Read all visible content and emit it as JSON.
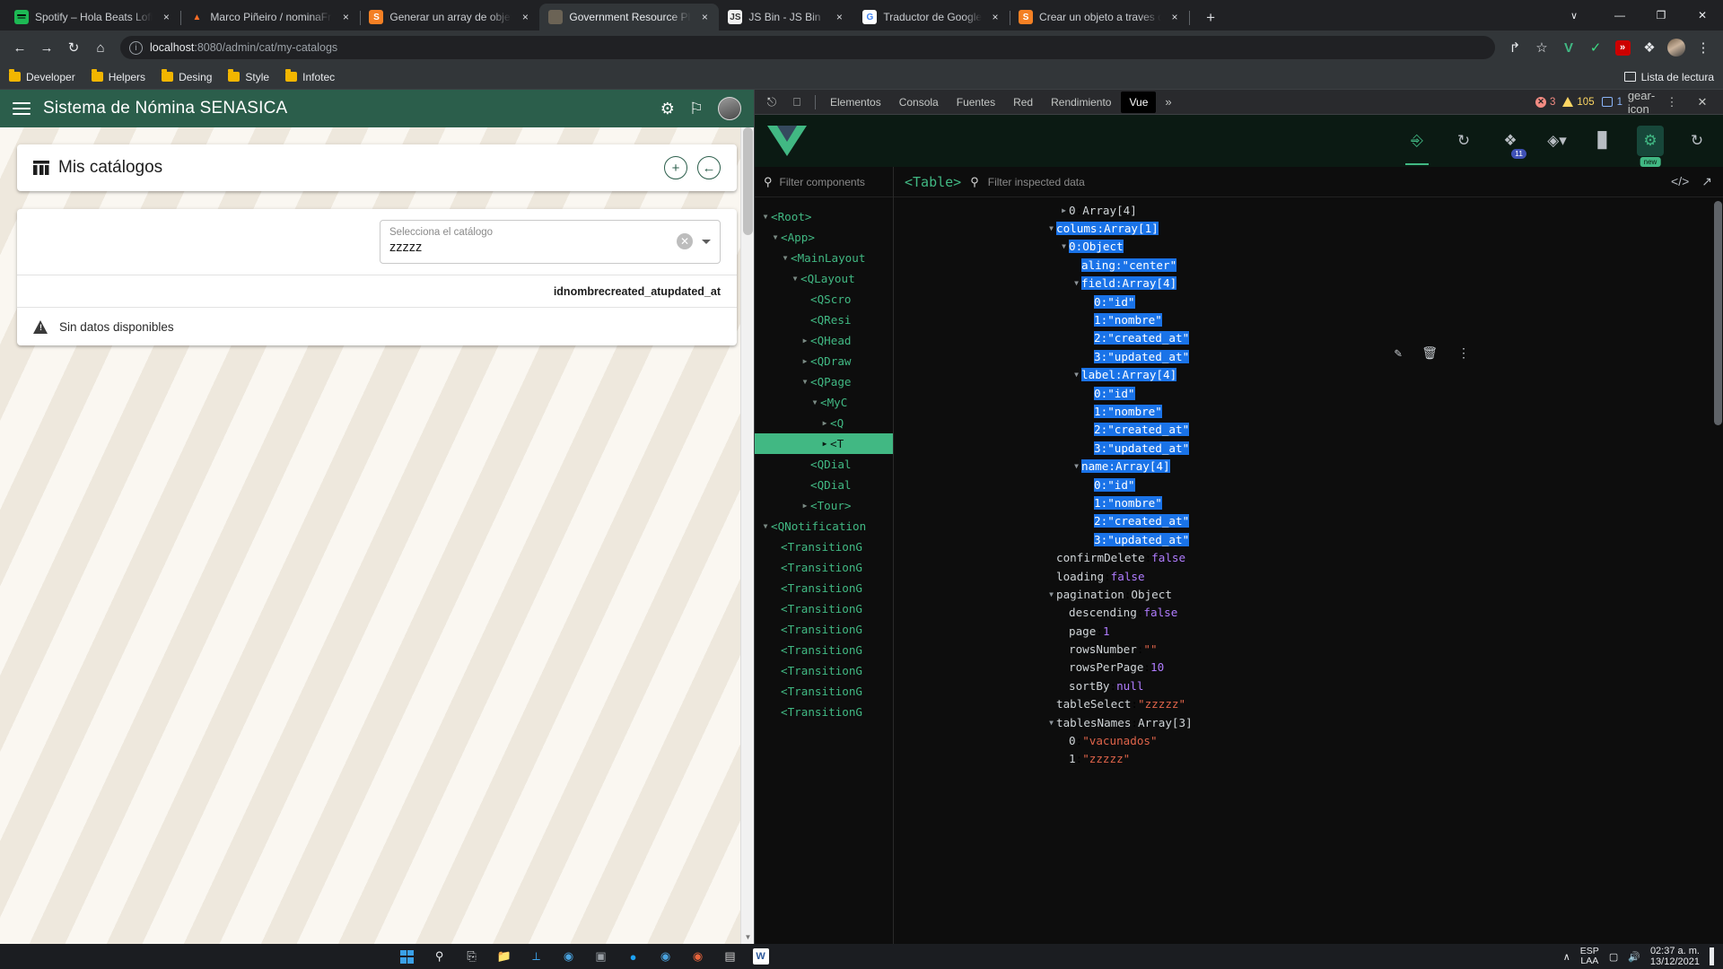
{
  "browser": {
    "tabs": [
      {
        "title": "Spotify – Hola Beats Lofi",
        "favicon": "spotify-icon",
        "active": false
      },
      {
        "title": "Marco Piñeiro / nominaFront · G",
        "favicon": "gitlab-icon",
        "active": false
      },
      {
        "title": "Generar un array de objetos a tr",
        "favicon": "stackoverflow-icon",
        "active": false
      },
      {
        "title": "Government Resource Planning",
        "favicon": "gob-icon",
        "active": true
      },
      {
        "title": "JS Bin - JS Bin",
        "favicon": "jsbin-icon",
        "active": false
      },
      {
        "title": "Traductor de Google",
        "favicon": "google-translate-icon",
        "active": false
      },
      {
        "title": "Crear un objeto a traves de un a",
        "favicon": "stackoverflow-icon",
        "active": false
      }
    ],
    "tab_close_label": "×",
    "new_tab_label": "+",
    "window_controls": {
      "tab_search": "∨",
      "minimize": "—",
      "maximize": "❐",
      "close": "✕"
    },
    "nav": {
      "back": "←",
      "forward": "→",
      "reload": "↻",
      "home": "⌂"
    },
    "omnibox": {
      "scheme_info": "ⓘ",
      "host": "localhost",
      "path": ":8080/admin/cat/my-catalogs"
    },
    "toolbar_right": {
      "share": "↱",
      "bookmark_star": "☆",
      "ext_vue": "V",
      "ext_shield": "✓",
      "ext_red": "»",
      "ext_puzzle": "❖",
      "menu": "⋮"
    },
    "bookmarks": [
      {
        "label": "Developer"
      },
      {
        "label": "Helpers"
      },
      {
        "label": "Desing"
      },
      {
        "label": "Style"
      },
      {
        "label": "Infotec"
      }
    ],
    "reading_list": "Lista de lectura"
  },
  "app": {
    "header": {
      "title": "Sistema de Nómina SENASICA",
      "menu_icon": "hamburger-icon",
      "settings_icon": "gears-icon",
      "flag_icon": "flag-icon",
      "avatar": "user-avatar"
    },
    "catalog_card": {
      "icon": "table-chart-icon",
      "title": "Mis catálogos",
      "add_button": "+",
      "back_button": "←"
    },
    "table_card": {
      "select": {
        "label": "Selecciona el catálogo",
        "value": "zzzzz",
        "clear_icon": "clear-circle-icon",
        "dropdown_icon": "chevron-down-icon"
      },
      "columns_concat": "idnombrecreated_atupdated_at",
      "empty_icon": "warning-icon",
      "empty_text": "Sin datos disponibles"
    }
  },
  "devtools": {
    "tabs": [
      {
        "label": "Elementos",
        "active": false
      },
      {
        "label": "Consola",
        "active": false
      },
      {
        "label": "Fuentes",
        "active": false
      },
      {
        "label": "Red",
        "active": false
      },
      {
        "label": "Rendimiento",
        "active": false
      },
      {
        "label": "Vue",
        "active": true
      }
    ],
    "inspect_icon": "cursor-inspect-icon",
    "device_icon": "device-toolbar-icon",
    "overflow": "»",
    "errors": "3",
    "warnings": "105",
    "messages": "1",
    "settings_icon": "gear-icon",
    "kebab_icon": "kebab-menu-icon",
    "vue": {
      "logo": "vue-logo",
      "toolbar_icons": [
        {
          "name": "components-tree-icon",
          "glyph": "⑂",
          "active": true,
          "badge": null
        },
        {
          "name": "timeline-history-icon",
          "glyph": "↺",
          "active": false,
          "badge": null
        },
        {
          "name": "pinia-store-icon",
          "glyph": "✲",
          "active": false,
          "badge": "11"
        },
        {
          "name": "routes-icon",
          "glyph": "❖",
          "active": false,
          "badge": null
        },
        {
          "name": "performance-icon",
          "glyph": "█",
          "active": false,
          "badge": null
        },
        {
          "name": "plugins-icon",
          "glyph": "❖",
          "active": false,
          "badge": "new"
        },
        {
          "name": "refresh-icon",
          "glyph": "↻",
          "active": false,
          "badge": null
        }
      ],
      "components_filter_placeholder": "Filter components",
      "inspected_filter_placeholder": "Filter inspected data",
      "inspected_component": "<Table>",
      "code_icon": "code-brackets-icon",
      "open-external-icon": "open-external-icon",
      "edit_icon": "pencil-icon",
      "delete_icon": "trash-icon",
      "more_icon": "kebab-menu-icon",
      "tree": [
        {
          "indent": 0,
          "twisty": "▼",
          "label": "<Root>",
          "selected": false
        },
        {
          "indent": 1,
          "twisty": "▼",
          "label": "<App>",
          "selected": false
        },
        {
          "indent": 2,
          "twisty": "▼",
          "label": "<MainLayout",
          "selected": false
        },
        {
          "indent": 3,
          "twisty": "▼",
          "label": "<QLayout",
          "selected": false
        },
        {
          "indent": 4,
          "twisty": "",
          "label": "<QScro",
          "selected": false
        },
        {
          "indent": 4,
          "twisty": "",
          "label": "<QResi",
          "selected": false
        },
        {
          "indent": 4,
          "twisty": "▶",
          "label": "<QHead",
          "selected": false
        },
        {
          "indent": 4,
          "twisty": "▶",
          "label": "<QDraw",
          "selected": false
        },
        {
          "indent": 4,
          "twisty": "▼",
          "label": "<QPage",
          "selected": false
        },
        {
          "indent": 5,
          "twisty": "▼",
          "label": "<MyC",
          "selected": false
        },
        {
          "indent": 6,
          "twisty": "▶",
          "label": "<Q",
          "selected": false
        },
        {
          "indent": 6,
          "twisty": "▶",
          "label": "<T",
          "selected": true
        },
        {
          "indent": 4,
          "twisty": "",
          "label": "<QDial",
          "selected": false
        },
        {
          "indent": 4,
          "twisty": "",
          "label": "<QDial",
          "selected": false
        },
        {
          "indent": 4,
          "twisty": "▶",
          "label": "<Tour>",
          "selected": false
        },
        {
          "indent": 0,
          "twisty": "▼",
          "label": "<QNotification",
          "selected": false
        },
        {
          "indent": 1,
          "twisty": "",
          "label": "<TransitionG",
          "selected": false
        },
        {
          "indent": 1,
          "twisty": "",
          "label": "<TransitionG",
          "selected": false
        },
        {
          "indent": 1,
          "twisty": "",
          "label": "<TransitionG",
          "selected": false
        },
        {
          "indent": 1,
          "twisty": "",
          "label": "<TransitionG",
          "selected": false
        },
        {
          "indent": 1,
          "twisty": "",
          "label": "<TransitionG",
          "selected": false
        },
        {
          "indent": 1,
          "twisty": "",
          "label": "<TransitionG",
          "selected": false
        },
        {
          "indent": 1,
          "twisty": "",
          "label": "<TransitionG",
          "selected": false
        },
        {
          "indent": 1,
          "twisty": "",
          "label": "<TransitionG",
          "selected": false
        },
        {
          "indent": 1,
          "twisty": "",
          "label": "<TransitionG",
          "selected": false
        }
      ],
      "inspected": [
        {
          "indent": 1,
          "twisty": "▶",
          "key": "0",
          "sep": ": ",
          "value": "Array[4]",
          "vtype": "type",
          "selected": false,
          "partial_top": true
        },
        {
          "indent": 0,
          "twisty": "▼",
          "key": "colums",
          "sep": ": ",
          "value": "Array[1]",
          "vtype": "type",
          "selected": true
        },
        {
          "indent": 1,
          "twisty": "▼",
          "key": "0",
          "sep": ": ",
          "value": "Object",
          "vtype": "type",
          "selected": true
        },
        {
          "indent": 2,
          "twisty": "",
          "key": "aling",
          "sep": ": ",
          "value": "\"center\"",
          "vtype": "str",
          "selected": true
        },
        {
          "indent": 2,
          "twisty": "▼",
          "key": "field",
          "sep": ": ",
          "value": "Array[4]",
          "vtype": "type",
          "selected": true
        },
        {
          "indent": 3,
          "twisty": "",
          "key": "0",
          "sep": ": ",
          "value": "\"id\"",
          "vtype": "str",
          "selected": true
        },
        {
          "indent": 3,
          "twisty": "",
          "key": "1",
          "sep": ": ",
          "value": "\"nombre\"",
          "vtype": "str",
          "selected": true
        },
        {
          "indent": 3,
          "twisty": "",
          "key": "2",
          "sep": ": ",
          "value": "\"created_at\"",
          "vtype": "str",
          "selected": true
        },
        {
          "indent": 3,
          "twisty": "",
          "key": "3",
          "sep": ": ",
          "value": "\"updated_at\"",
          "vtype": "str",
          "selected": true
        },
        {
          "indent": 2,
          "twisty": "▼",
          "key": "label",
          "sep": ": ",
          "value": "Array[4]",
          "vtype": "type",
          "selected": true
        },
        {
          "indent": 3,
          "twisty": "",
          "key": "0",
          "sep": ": ",
          "value": "\"id\"",
          "vtype": "str",
          "selected": true
        },
        {
          "indent": 3,
          "twisty": "",
          "key": "1",
          "sep": ": ",
          "value": "\"nombre\"",
          "vtype": "str",
          "selected": true
        },
        {
          "indent": 3,
          "twisty": "",
          "key": "2",
          "sep": ": ",
          "value": "\"created_at\"",
          "vtype": "str",
          "selected": true
        },
        {
          "indent": 3,
          "twisty": "",
          "key": "3",
          "sep": ": ",
          "value": "\"updated_at\"",
          "vtype": "str",
          "selected": true
        },
        {
          "indent": 2,
          "twisty": "▼",
          "key": "name",
          "sep": ": ",
          "value": "Array[4]",
          "vtype": "type",
          "selected": true
        },
        {
          "indent": 3,
          "twisty": "",
          "key": "0",
          "sep": ": ",
          "value": "\"id\"",
          "vtype": "str",
          "selected": true
        },
        {
          "indent": 3,
          "twisty": "",
          "key": "1",
          "sep": ": ",
          "value": "\"nombre\"",
          "vtype": "str",
          "selected": true
        },
        {
          "indent": 3,
          "twisty": "",
          "key": "2",
          "sep": ": ",
          "value": "\"created_at\"",
          "vtype": "str",
          "selected": true
        },
        {
          "indent": 3,
          "twisty": "",
          "key": "3",
          "sep": ": ",
          "value": "\"updated_at\"",
          "vtype": "str",
          "selected": true
        },
        {
          "indent": 0,
          "twisty": "",
          "key": "confirmDelete",
          "sep": ": ",
          "value": "false",
          "vtype": "bool",
          "selected": false
        },
        {
          "indent": 0,
          "twisty": "",
          "key": "loading",
          "sep": ": ",
          "value": "false",
          "vtype": "bool",
          "selected": false
        },
        {
          "indent": 0,
          "twisty": "▼",
          "key": "pagination",
          "sep": ": ",
          "value": "Object",
          "vtype": "type",
          "selected": false
        },
        {
          "indent": 1,
          "twisty": "",
          "key": "descending",
          "sep": ": ",
          "value": "false",
          "vtype": "bool",
          "selected": false
        },
        {
          "indent": 1,
          "twisty": "",
          "key": "page",
          "sep": ": ",
          "value": "1",
          "vtype": "num",
          "selected": false
        },
        {
          "indent": 1,
          "twisty": "",
          "key": "rowsNumber",
          "sep": ": ",
          "value": "\"\"",
          "vtype": "str",
          "selected": false
        },
        {
          "indent": 1,
          "twisty": "",
          "key": "rowsPerPage",
          "sep": ": ",
          "value": "10",
          "vtype": "num",
          "selected": false
        },
        {
          "indent": 1,
          "twisty": "",
          "key": "sortBy",
          "sep": ": ",
          "value": "null",
          "vtype": "bool",
          "selected": false
        },
        {
          "indent": 0,
          "twisty": "",
          "key": "tableSelect",
          "sep": ": ",
          "value": "\"zzzzz\"",
          "vtype": "str",
          "selected": false
        },
        {
          "indent": 0,
          "twisty": "▼",
          "key": "tablesNames",
          "sep": ": ",
          "value": "Array[3]",
          "vtype": "type",
          "selected": false
        },
        {
          "indent": 1,
          "twisty": "",
          "key": "0",
          "sep": ": ",
          "value": "\"vacunados\"",
          "vtype": "str",
          "selected": false
        },
        {
          "indent": 1,
          "twisty": "",
          "key": "1",
          "sep": ": ",
          "value": "\"zzzzz\"",
          "vtype": "str",
          "selected": false
        }
      ]
    }
  },
  "taskbar": {
    "apps": [
      {
        "name": "start-button",
        "glyph": "win"
      },
      {
        "name": "search-icon",
        "glyph": "○"
      },
      {
        "name": "task-view-icon",
        "glyph": "❐"
      },
      {
        "name": "file-explorer-icon",
        "glyph": "▬"
      },
      {
        "name": "vscode-icon",
        "glyph": "✕"
      },
      {
        "name": "edge-icon",
        "glyph": "◔"
      },
      {
        "name": "teams-icon",
        "glyph": "▣"
      },
      {
        "name": "twitter-icon",
        "glyph": "●"
      },
      {
        "name": "chrome-icon",
        "glyph": "◉"
      },
      {
        "name": "firefox-icon",
        "glyph": "◌"
      },
      {
        "name": "terminal-icon",
        "glyph": "▤"
      },
      {
        "name": "word-icon",
        "glyph": "W"
      }
    ],
    "tray": {
      "chevron": "∧",
      "lang_top": "ESP",
      "lang_bottom": "LAA",
      "network_icon": "network-icon",
      "volume_icon": "volume-icon",
      "time": "02:37 a. m.",
      "date": "13/12/2021",
      "notification_icon": "notification-icon"
    }
  }
}
